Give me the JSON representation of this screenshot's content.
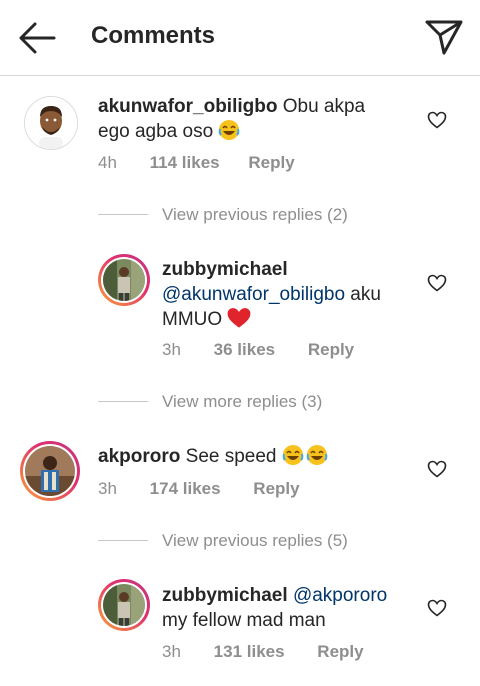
{
  "header": {
    "title": "Comments",
    "back_icon": "arrow-left-icon",
    "send_icon": "paper-plane-icon"
  },
  "comments": [
    {
      "username": "akunwafor_obiligbo",
      "text": "Obu akpa ego agba oso",
      "emoji": "😂",
      "time": "4h",
      "likes": "114 likes",
      "reply": "Reply",
      "view_replies": "View previous replies (2)"
    },
    {
      "username": "zubbymichael",
      "mention": "@akunwafor_obiligbo",
      "text": "aku MMUO",
      "emoji": "❤️",
      "time": "3h",
      "likes": "36 likes",
      "reply": "Reply",
      "view_replies": "View more replies (3)"
    },
    {
      "username": "akpororo",
      "text": "See speed",
      "emoji": "😂😂",
      "time": "3h",
      "likes": "174 likes",
      "reply": "Reply",
      "view_replies": "View previous replies (5)"
    },
    {
      "username": "zubbymichael",
      "mention": "@akpororo",
      "text": "my fellow mad man",
      "time": "3h",
      "likes": "131 likes",
      "reply": "Reply"
    }
  ],
  "colors": {
    "text": "#262626",
    "muted": "#8e8e8e",
    "mention": "#003569",
    "heart": "#ed2a2a"
  }
}
